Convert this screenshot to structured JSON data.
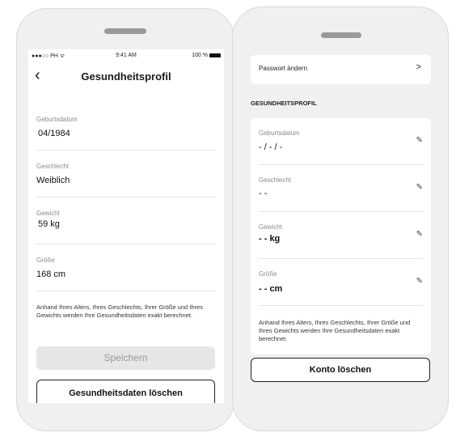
{
  "left_screen": {
    "status": {
      "carrier": "●●●○○ PH ᯤ",
      "time": "9:41 AM",
      "battery": "100 %"
    },
    "back_icon": "chevron-left-icon",
    "title": "Gesundheitsprofil",
    "fields": [
      {
        "label": "Geburtsdatum",
        "value": "04/1984"
      },
      {
        "label": "Geschlecht",
        "value": "Weiblich"
      },
      {
        "label": "Gewicht",
        "value": "59 kg"
      },
      {
        "label": "Größe",
        "value": "168 cm"
      }
    ],
    "info_text": "Anhand Ihres Alters, Ihres Geschlechts, Ihrer Größe und Ihres Gewichts werden Ihre Gesundheitsdaten exakt berechnet.",
    "save_label": "Speichern",
    "delete_label": "Gesundheitsdaten löschen"
  },
  "right_screen": {
    "password_row": {
      "label": "Passwort ändern",
      "chevron": ">"
    },
    "section_title": "GESUNDHEITSPROFIL",
    "fields": [
      {
        "label": "Geburtsdatum",
        "value": "- / - / -"
      },
      {
        "label": "Geschlecht",
        "value": "- -"
      },
      {
        "label": "Gewicht",
        "value": "- - kg"
      },
      {
        "label": "Größe",
        "value": "- - cm"
      }
    ],
    "edit_icon": "pencil-icon",
    "info_text": "Anhand Ihres Alters, Ihres Geschlechts, Ihrer Größe und Ihres Gewichts werden Ihre Gesundheitsdaten exakt berechnet.",
    "delete_account_label": "Konto löschen"
  },
  "colors": {
    "background": "#f0f0f0",
    "screen": "#ffffff",
    "disabled": "#e6e6e6",
    "text": "#1a1a1a",
    "muted": "#8a8a8a"
  }
}
